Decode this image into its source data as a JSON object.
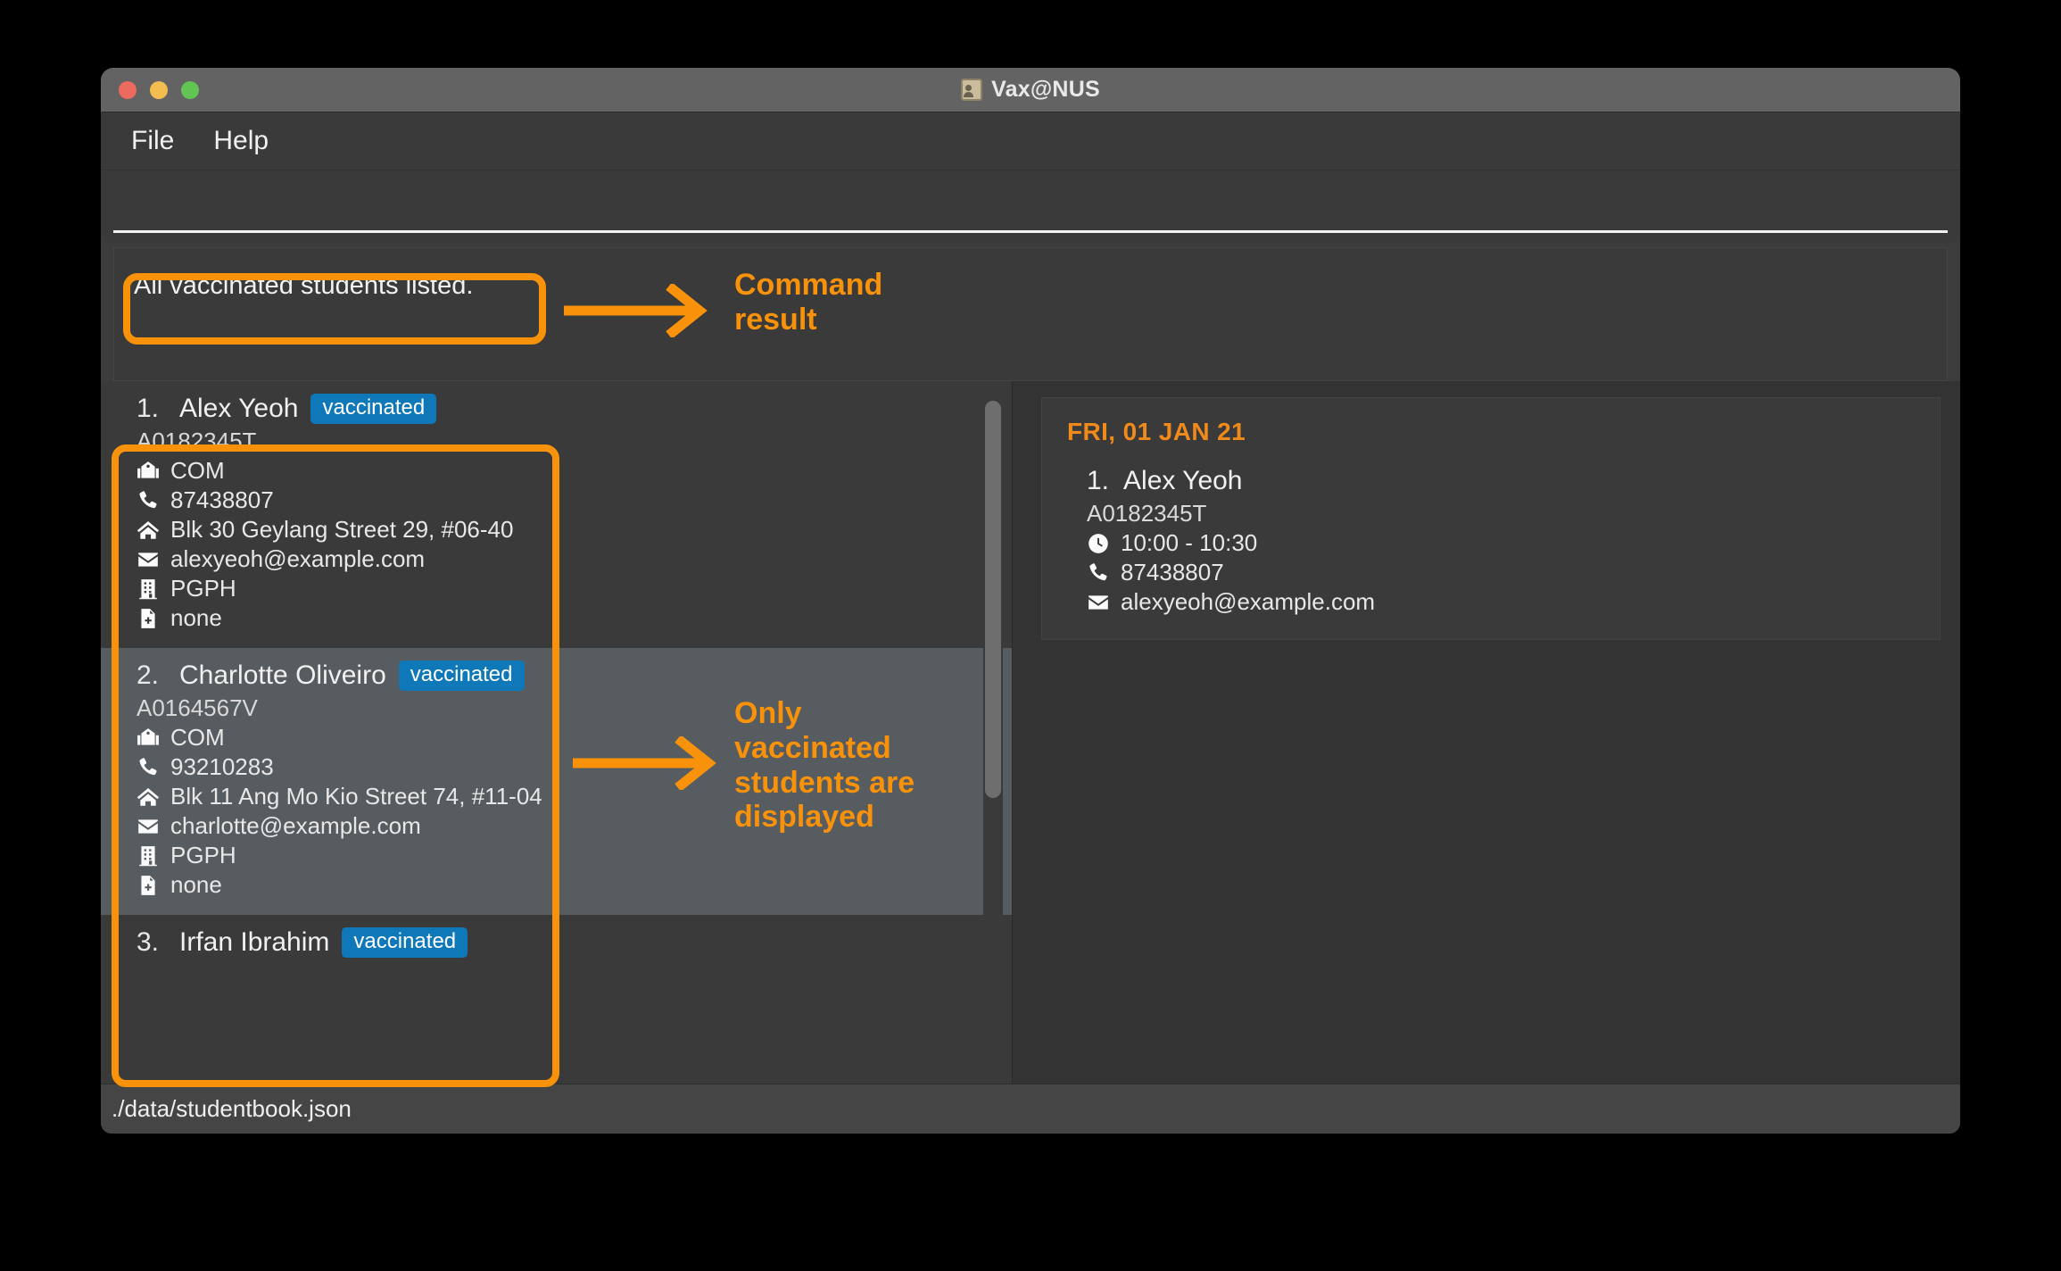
{
  "window": {
    "title": "Vax@NUS",
    "title_icon": "address-book-icon",
    "traffic_lights": [
      "close",
      "minimize",
      "maximize"
    ]
  },
  "menubar": {
    "items": [
      {
        "label": "File"
      },
      {
        "label": "Help"
      }
    ]
  },
  "command": {
    "input_value": "",
    "placeholder": "",
    "result_text": "All vaccinated students listed."
  },
  "student_list": {
    "scrollbar": {
      "visible": true
    },
    "students": [
      {
        "index": "1.",
        "name": "Alex Yeoh",
        "badge": "vaccinated",
        "student_id": "A0182345T",
        "faculty": "COM",
        "phone": "87438807",
        "address": "Blk 30 Geylang Street 29, #06-40",
        "email": "alexyeoh@example.com",
        "residence": "PGPH",
        "medical": "none",
        "selected": false
      },
      {
        "index": "2.",
        "name": "Charlotte Oliveiro",
        "badge": "vaccinated",
        "student_id": "A0164567V",
        "faculty": "COM",
        "phone": "93210283",
        "address": "Blk 11 Ang Mo Kio Street 74, #11-04",
        "email": "charlotte@example.com",
        "residence": "PGPH",
        "medical": "none",
        "selected": true
      },
      {
        "index": "3.",
        "name": "Irfan Ibrahim",
        "badge": "vaccinated",
        "student_id": "",
        "selected": false,
        "clipped": true
      }
    ]
  },
  "appointments": {
    "date_header": "FRI, 01 JAN 21",
    "entries": [
      {
        "index": "1.",
        "name": "Alex Yeoh",
        "student_id": "A0182345T",
        "time": "10:00 - 10:30",
        "phone": "87438807",
        "email": "alexyeoh@example.com"
      }
    ]
  },
  "statusbar": {
    "file_path": "./data/studentbook.json"
  },
  "annotations": {
    "accent_color": "#f8920b",
    "command_result_label": "Command\nresult",
    "list_label": "Only\nvaccinated\nstudents are\ndisplayed"
  },
  "colors": {
    "badge_blue": "#0f78b9",
    "accent_orange": "#f8920b",
    "date_orange": "#f08a1b",
    "window_bg": "#3a3a3a",
    "selected_row": "#565c5f"
  }
}
